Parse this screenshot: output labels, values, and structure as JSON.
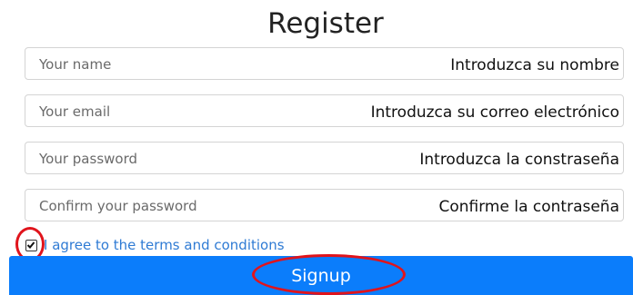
{
  "form": {
    "title": "Register",
    "fields": [
      {
        "placeholder": "Your name",
        "translation": "Introduzca su nombre"
      },
      {
        "placeholder": "Your email",
        "translation": "Introduzca su correo electrónico"
      },
      {
        "placeholder": "Your password",
        "translation": "Introduzca la constraseña"
      },
      {
        "placeholder": "Confirm your password",
        "translation": "Confirme la contraseña"
      }
    ],
    "terms_label": "I agree to the terms and conditions",
    "terms_checked": true,
    "signup_label": "Signup"
  },
  "colors": {
    "primary": "#0b7dfb",
    "link": "#2f7bd4",
    "annotation": "#e0141c"
  },
  "icons": {
    "checkbox": "checkmark-icon"
  }
}
